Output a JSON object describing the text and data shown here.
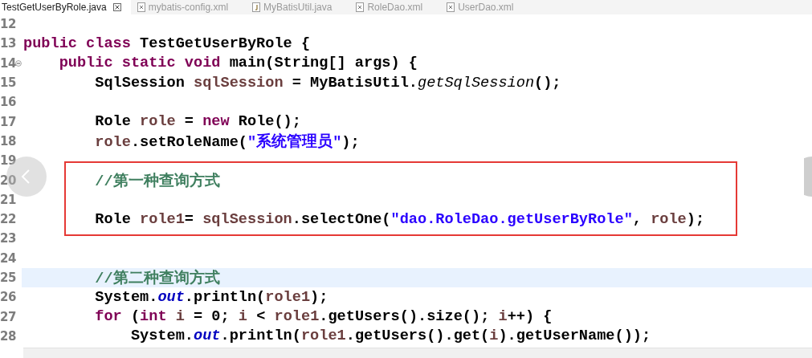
{
  "tabs": [
    {
      "label": "TestGetUserByRole.java",
      "selected": true
    },
    {
      "label": "mybatis-config.xml",
      "selected": false,
      "kind": "xml"
    },
    {
      "label": "MyBatisUtil.java",
      "selected": false,
      "kind": "java"
    },
    {
      "label": "RoleDao.xml",
      "selected": false,
      "kind": "xml"
    },
    {
      "label": "UserDao.xml",
      "selected": false,
      "kind": "xml"
    }
  ],
  "lines": [
    {
      "number": "12"
    },
    {
      "number": "13",
      "tokens": [
        {
          "kind": "kw",
          "text": "public class "
        },
        {
          "kind": "plain",
          "text": "TestGetUserByRole {"
        }
      ]
    },
    {
      "number": "14",
      "fold": true,
      "tokens": [
        {
          "kind": "kw",
          "text": "    public static void "
        },
        {
          "kind": "plain",
          "text": "main(String[] args) {"
        }
      ]
    },
    {
      "number": "15",
      "tokens": [
        {
          "kind": "plain",
          "text": "        SqlSession "
        },
        {
          "kind": "var",
          "text": "sqlSession"
        },
        {
          "kind": "plain",
          "text": " = MyBatisUtil."
        },
        {
          "kind": "static",
          "text": "getSqlSession"
        },
        {
          "kind": "plain",
          "text": "();"
        }
      ]
    },
    {
      "number": "16"
    },
    {
      "number": "17",
      "tokens": [
        {
          "kind": "plain",
          "text": "        Role "
        },
        {
          "kind": "var",
          "text": "role"
        },
        {
          "kind": "plain",
          "text": " = "
        },
        {
          "kind": "kw",
          "text": "new "
        },
        {
          "kind": "plain",
          "text": "Role();"
        }
      ]
    },
    {
      "number": "18",
      "tokens": [
        {
          "kind": "var",
          "text": "        role"
        },
        {
          "kind": "plain",
          "text": ".setRoleName("
        },
        {
          "kind": "str",
          "text": "\"系统管理员\""
        },
        {
          "kind": "plain",
          "text": ");"
        }
      ]
    },
    {
      "number": "19"
    },
    {
      "number": "20",
      "boxed": true,
      "tokens": [
        {
          "kind": "comment",
          "text": "        //第一种查询方式"
        }
      ]
    },
    {
      "number": "21",
      "boxed": true
    },
    {
      "number": "22",
      "boxed": true,
      "tokens": [
        {
          "kind": "plain",
          "text": "        Role "
        },
        {
          "kind": "var",
          "text": "role1"
        },
        {
          "kind": "plain",
          "text": "= "
        },
        {
          "kind": "var",
          "text": "sqlSession"
        },
        {
          "kind": "plain",
          "text": ".selectOne("
        },
        {
          "kind": "str",
          "text": "\"dao.RoleDao.getUserByRole\""
        },
        {
          "kind": "plain",
          "text": ", "
        },
        {
          "kind": "var",
          "text": "role"
        },
        {
          "kind": "plain",
          "text": ");"
        }
      ]
    },
    {
      "number": "23"
    },
    {
      "number": "24"
    },
    {
      "number": "25",
      "current": true,
      "tokens": [
        {
          "kind": "comment",
          "text": "        //第二种查询方式"
        }
      ]
    },
    {
      "number": "26",
      "tokens": [
        {
          "kind": "plain",
          "text": "        System."
        },
        {
          "kind": "field",
          "text": "out"
        },
        {
          "kind": "plain",
          "text": ".println("
        },
        {
          "kind": "var",
          "text": "role1"
        },
        {
          "kind": "plain",
          "text": ");"
        }
      ]
    },
    {
      "number": "27",
      "tokens": [
        {
          "kind": "kw",
          "text": "        for "
        },
        {
          "kind": "plain",
          "text": "("
        },
        {
          "kind": "kw",
          "text": "int "
        },
        {
          "kind": "var",
          "text": "i"
        },
        {
          "kind": "plain",
          "text": " = 0; "
        },
        {
          "kind": "var",
          "text": "i"
        },
        {
          "kind": "plain",
          "text": " < "
        },
        {
          "kind": "var",
          "text": "role1"
        },
        {
          "kind": "plain",
          "text": ".getUsers().size(); "
        },
        {
          "kind": "var",
          "text": "i"
        },
        {
          "kind": "plain",
          "text": "++) {"
        }
      ]
    },
    {
      "number": "28",
      "tokens": [
        {
          "kind": "plain",
          "text": "            System."
        },
        {
          "kind": "field",
          "text": "out"
        },
        {
          "kind": "plain",
          "text": ".println("
        },
        {
          "kind": "var",
          "text": "role1"
        },
        {
          "kind": "plain",
          "text": ".getUsers().get("
        },
        {
          "kind": "var",
          "text": "i"
        },
        {
          "kind": "plain",
          "text": ").getUserName());"
        }
      ]
    }
  ]
}
